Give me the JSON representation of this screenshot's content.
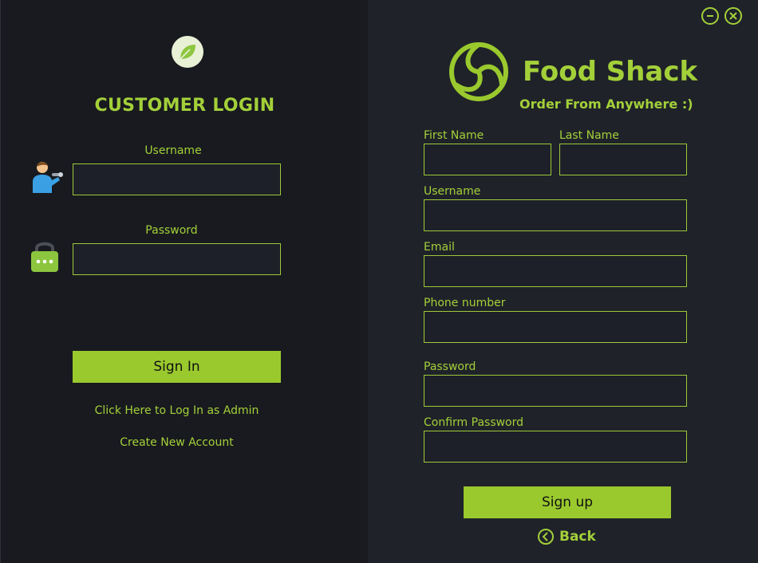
{
  "login": {
    "title": "CUSTOMER LOGIN",
    "username_label": "Username",
    "password_label": "Password",
    "username_value": "",
    "password_value": "",
    "signin_label": "Sign In",
    "admin_link": "Click Here to Log In as Admin",
    "create_link": "Create New Account"
  },
  "signup": {
    "brand": "Food Shack",
    "tagline": "Order From Anywhere :)",
    "first_name_label": "First Name",
    "last_name_label": "Last Name",
    "username_label": "Username",
    "email_label": "Email",
    "phone_label": "Phone number",
    "password_label": "Password",
    "confirm_label": "Confirm Password",
    "signup_label": "Sign up",
    "back_label": "Back"
  },
  "colors": {
    "accent": "#a3d039",
    "button": "#9ac92e",
    "left_bg": "#181a1f",
    "right_bg": "#1f2229"
  },
  "icons": [
    "leaf-icon",
    "user-icon",
    "lock-icon",
    "brand-logo-icon",
    "minimize-icon",
    "close-icon",
    "back-arrow-icon"
  ]
}
